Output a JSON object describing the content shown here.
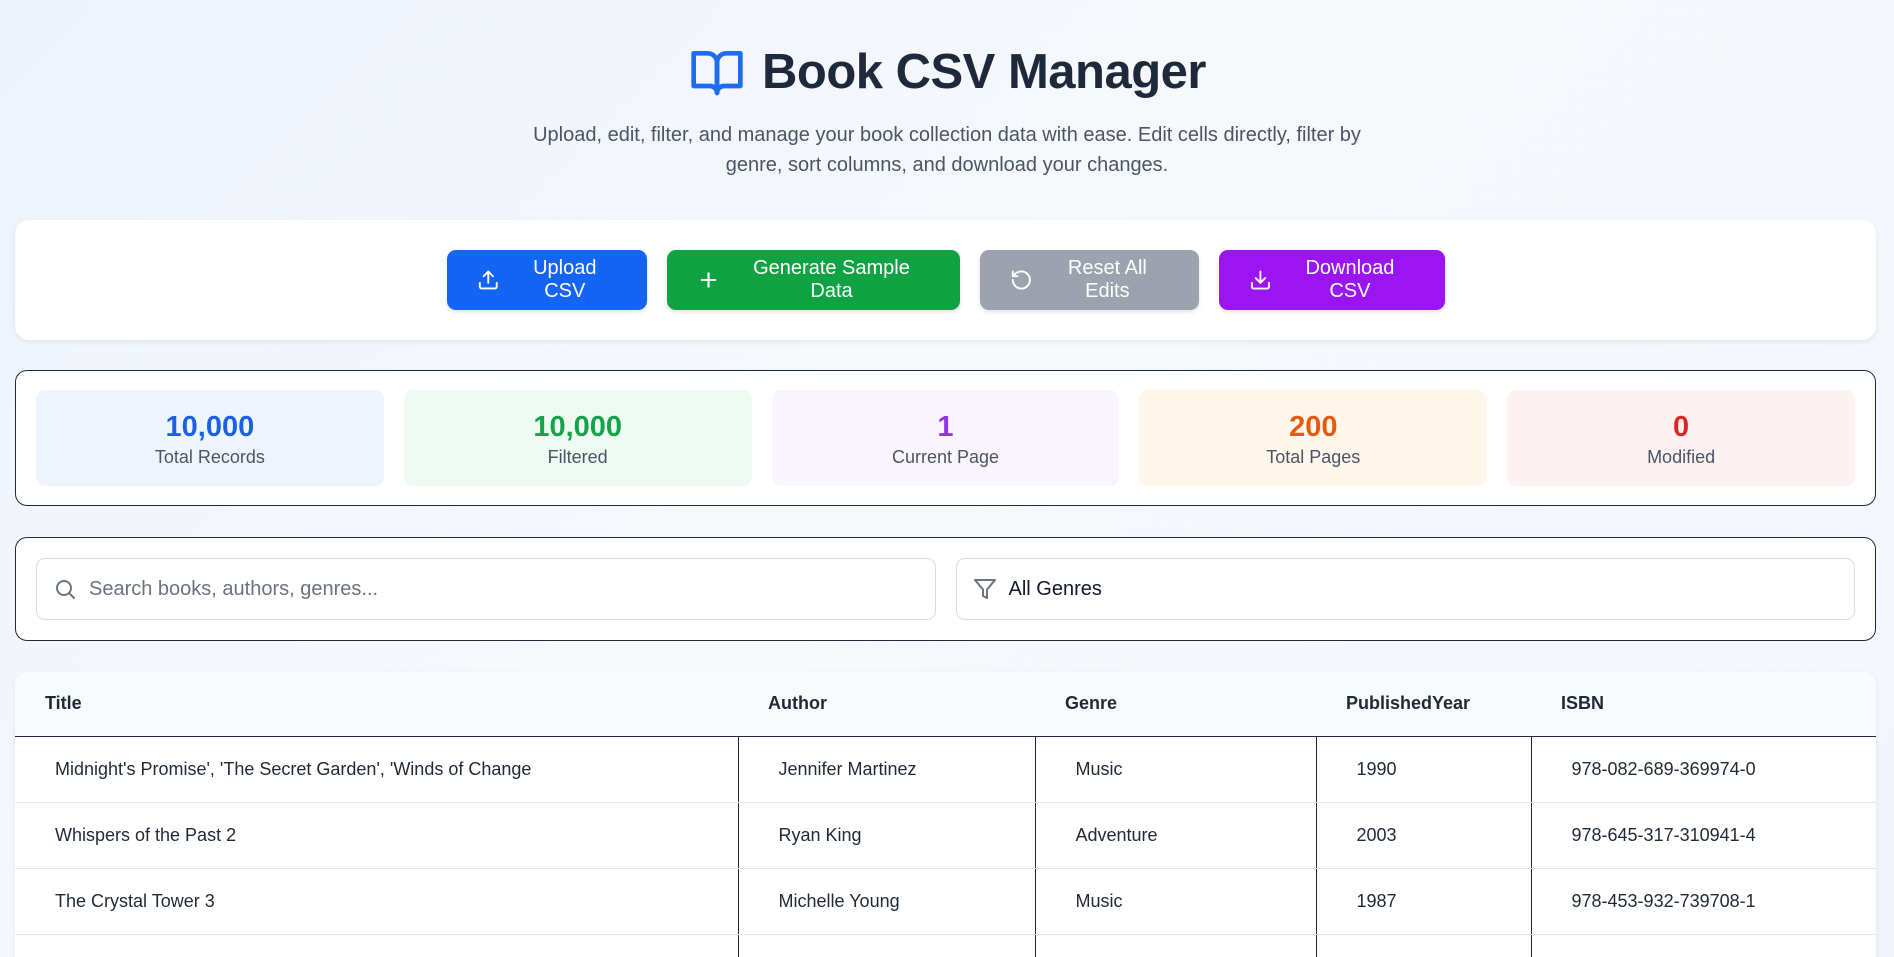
{
  "header": {
    "title": "Book CSV Manager",
    "subtitle": "Upload, edit, filter, and manage your book collection data with ease. Edit cells directly, filter by genre, sort columns, and download your changes.",
    "icon": "book-open-icon"
  },
  "toolbar": {
    "upload_label": "Upload CSV",
    "generate_label": "Generate Sample Data",
    "reset_label": "Reset All Edits",
    "download_label": "Download CSV"
  },
  "stats": [
    {
      "value": "10,000",
      "label": "Total Records",
      "color": "#1d5fe8"
    },
    {
      "value": "10,000",
      "label": "Filtered",
      "color": "#16a34a"
    },
    {
      "value": "1",
      "label": "Current Page",
      "color": "#9333ea"
    },
    {
      "value": "200",
      "label": "Total Pages",
      "color": "#ea580c"
    },
    {
      "value": "0",
      "label": "Modified",
      "color": "#dc2626"
    }
  ],
  "filters": {
    "search_placeholder": "Search books, authors, genres...",
    "search_value": "",
    "genre_selected": "All Genres"
  },
  "table": {
    "columns": [
      "Title",
      "Author",
      "Genre",
      "PublishedYear",
      "ISBN"
    ],
    "rows": [
      [
        "Midnight's Promise', 'The Secret Garden', 'Winds of Change",
        "Jennifer Martinez",
        "Music",
        "1990",
        "978-082-689-369974-0"
      ],
      [
        "Whispers of the Past 2",
        "Ryan King",
        "Adventure",
        "2003",
        "978-645-317-310941-4"
      ],
      [
        "The Crystal Tower 3",
        "Michelle Young",
        "Music",
        "1987",
        "978-453-932-739708-1"
      ]
    ]
  },
  "colors": {
    "upload": "#1565f5",
    "generate": "#0fa343",
    "reset": "#9ca3af",
    "download": "#9b15f3",
    "title_icon": "#1d6cf2"
  }
}
